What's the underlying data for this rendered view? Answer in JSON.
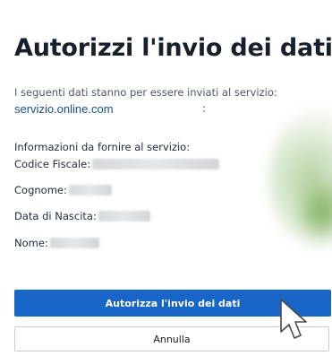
{
  "dialog": {
    "title": "Autorizzi l'invio dei dati?",
    "intro_text": "I seguenti dati stanno per essere inviati al servizio:",
    "service_name": "servizio.online.com",
    "service_suffix": ":",
    "info_heading": "Informazioni da fornire al servizio:",
    "fields": [
      {
        "label": "Codice Fiscale:"
      },
      {
        "label": "Cognome:"
      },
      {
        "label": "Data di Nascita:"
      },
      {
        "label": "Nome:"
      }
    ],
    "authorize_button": "Autorizza l'invio dei dati",
    "cancel_button": "Annulla"
  },
  "colors": {
    "primary": "#1766c7",
    "link": "#1a4f8a"
  },
  "icons": {
    "cursor": "pointer-cursor-icon"
  }
}
